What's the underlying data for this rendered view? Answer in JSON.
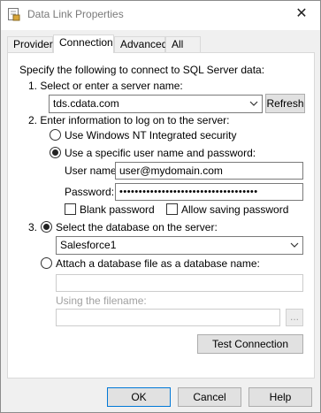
{
  "window": {
    "title": "Data Link Properties",
    "close_glyph": "✕"
  },
  "tabs": [
    {
      "label": "Provider",
      "active": false
    },
    {
      "label": "Connection",
      "active": true
    },
    {
      "label": "Advanced",
      "active": false
    },
    {
      "label": "All",
      "active": false
    }
  ],
  "connection": {
    "intro": "Specify the following to connect to SQL Server data:",
    "step1_label": "1. Select or enter a server name:",
    "server_value": "tds.cdata.com",
    "refresh_label": "Refresh",
    "step2_label": "2. Enter information to log on to the server:",
    "radio_nt_label": "Use Windows NT Integrated security",
    "radio_specific_label": "Use a specific user name and password:",
    "username_label": "User name:",
    "username_value": "user@mydomain.com",
    "password_label": "Password:",
    "password_value": "••••••••••••••••••••••••••••••••••••",
    "blank_password_label": "Blank password",
    "allow_saving_label": "Allow saving password",
    "step3_number": "3.",
    "radio_select_db_label": "Select the database on the server:",
    "database_value": "Salesforce1",
    "radio_attach_label": "Attach a database file as a database name:",
    "attach_name_value": "",
    "using_filename_label": "Using the filename:",
    "filename_value": "",
    "browse_label": "...",
    "test_connection_label": "Test Connection"
  },
  "footer": {
    "ok_label": "OK",
    "cancel_label": "Cancel",
    "help_label": "Help"
  }
}
